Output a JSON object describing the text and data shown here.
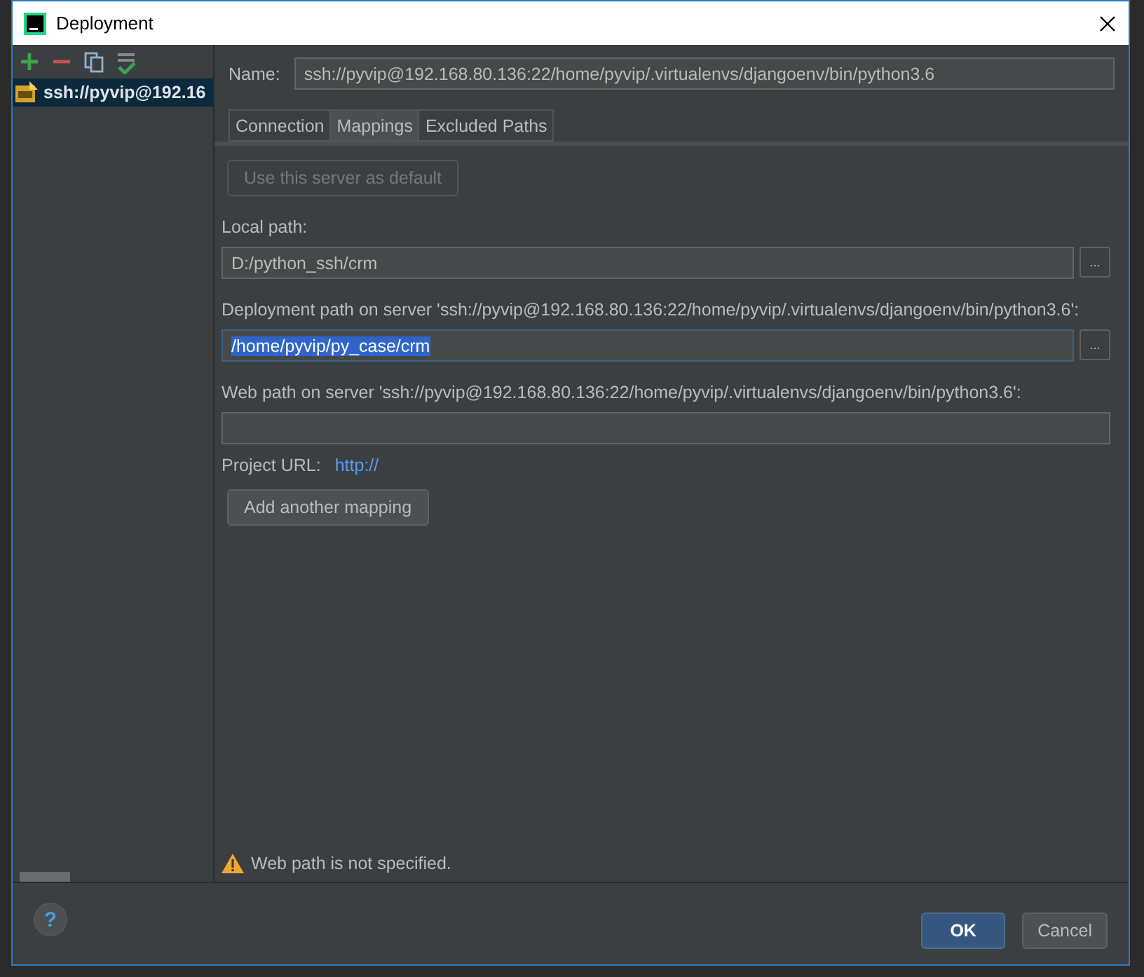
{
  "window": {
    "title": "Deployment"
  },
  "toolbar": {
    "buttons": [
      {
        "kind": "add"
      },
      {
        "kind": "remove"
      },
      {
        "kind": "copy"
      },
      {
        "kind": "default"
      }
    ]
  },
  "servers": [
    {
      "label": "ssh://pyvip@192.16",
      "selected": true
    }
  ],
  "name_field": {
    "label": "Name:",
    "value": "ssh://pyvip@192.168.80.136:22/home/pyvip/.virtualenvs/djangoenv/bin/python3.6"
  },
  "tabs": [
    {
      "label": "Connection",
      "selected": false
    },
    {
      "label": "Mappings",
      "selected": true
    },
    {
      "label": "Excluded Paths",
      "selected": false
    }
  ],
  "default_button": {
    "label": "Use this server as default",
    "disabled": true
  },
  "local_path": {
    "label": "Local path:",
    "value": "D:/python_ssh/crm",
    "browse": "..."
  },
  "deployment_path": {
    "label": "Deployment path on server 'ssh://pyvip@192.168.80.136:22/home/pyvip/.virtualenvs/djangoenv/bin/python3.6':",
    "value": "/home/pyvip/py_case/crm",
    "browse": "...",
    "focused": true
  },
  "web_path": {
    "label": "Web path on server 'ssh://pyvip@192.168.80.136:22/home/pyvip/.virtualenvs/djangoenv/bin/python3.6':"
  },
  "project_url": {
    "label": "Project URL:",
    "link": "http://"
  },
  "add_mapping_button": "Add another mapping",
  "warning": "Web path is not specified.",
  "footer": {
    "help": "?",
    "buttons": [
      {
        "label": "OK",
        "kind": "primary"
      },
      {
        "label": "Cancel",
        "kind": "normal"
      }
    ]
  }
}
